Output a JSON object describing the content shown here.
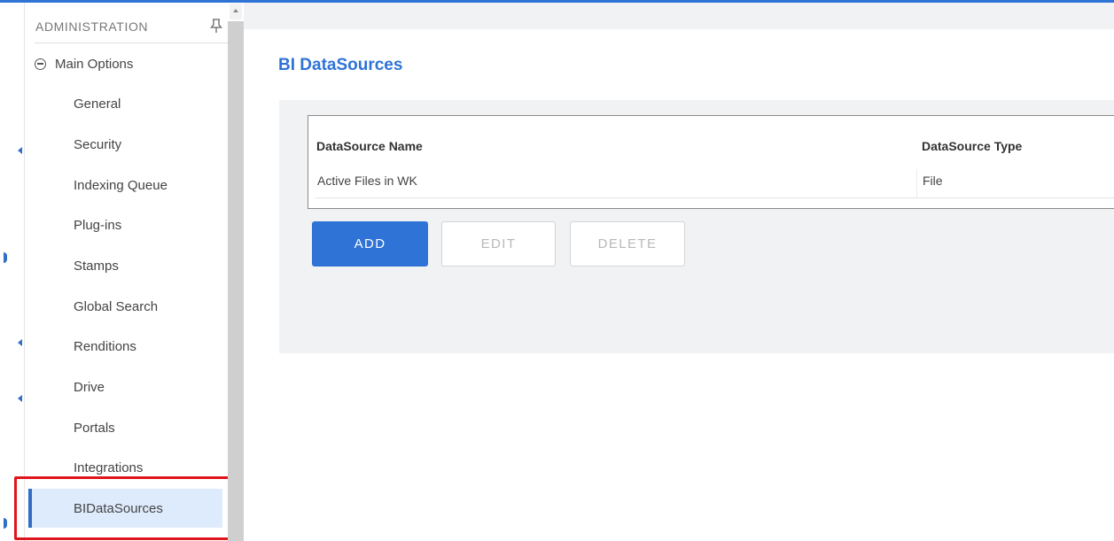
{
  "sidebar": {
    "header": "ADMINISTRATION",
    "group_label": "Main Options",
    "items": [
      {
        "label": "General"
      },
      {
        "label": "Security"
      },
      {
        "label": "Indexing Queue"
      },
      {
        "label": "Plug-ins"
      },
      {
        "label": "Stamps"
      },
      {
        "label": "Global Search"
      },
      {
        "label": "Renditions"
      },
      {
        "label": "Drive"
      },
      {
        "label": "Portals"
      },
      {
        "label": "Integrations"
      },
      {
        "label": "BIDataSources",
        "active": true
      }
    ]
  },
  "main": {
    "title": "BI DataSources",
    "table": {
      "columns": [
        "DataSource Name",
        "DataSource Type"
      ],
      "rows": [
        [
          "Active Files in WK",
          "File"
        ]
      ]
    },
    "buttons": {
      "add": "ADD",
      "edit": "EDIT",
      "delete": "DELETE"
    }
  },
  "colors": {
    "accent": "#2f73d6",
    "active_bg": "#deebfc",
    "highlight": "#e0151b"
  },
  "icons": [
    "pin-icon",
    "collapse-circle-icon",
    "scroll-up-arrow-icon"
  ]
}
